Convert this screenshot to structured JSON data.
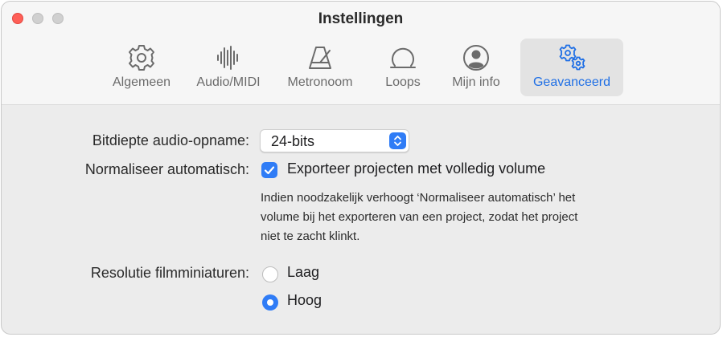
{
  "window": {
    "title": "Instellingen"
  },
  "tabs": [
    {
      "label": "Algemeen",
      "icon": "gear-icon",
      "active": false
    },
    {
      "label": "Audio/MIDI",
      "icon": "waveform-icon",
      "active": false
    },
    {
      "label": "Metronoom",
      "icon": "metronome-icon",
      "active": false
    },
    {
      "label": "Loops",
      "icon": "loop-icon",
      "active": false
    },
    {
      "label": "Mijn info",
      "icon": "person-circle-icon",
      "active": false
    },
    {
      "label": "Geavanceerd",
      "icon": "gears-icon",
      "active": true
    }
  ],
  "settings": {
    "bit_depth": {
      "label": "Bitdiepte audio-opname:",
      "value": "24-bits"
    },
    "normalize": {
      "label": "Normaliseer automatisch:",
      "checkbox_label": "Exporteer projecten met volledig volume",
      "checked": true,
      "help_lines": [
        "Indien noodzakelijk verhoogt ‘Normaliseer automatisch’ het",
        "volume bij het exporteren van een project, zodat het project",
        "niet te zacht klinkt."
      ]
    },
    "thumbnail_resolution": {
      "label": "Resolutie filmminiaturen:",
      "options": [
        {
          "label": "Laag",
          "selected": false
        },
        {
          "label": "Hoog",
          "selected": true
        }
      ]
    }
  },
  "colors": {
    "accent": "#2f7cf6",
    "active_tab_text": "#1f6fe5",
    "close_button": "#fe5f57"
  }
}
